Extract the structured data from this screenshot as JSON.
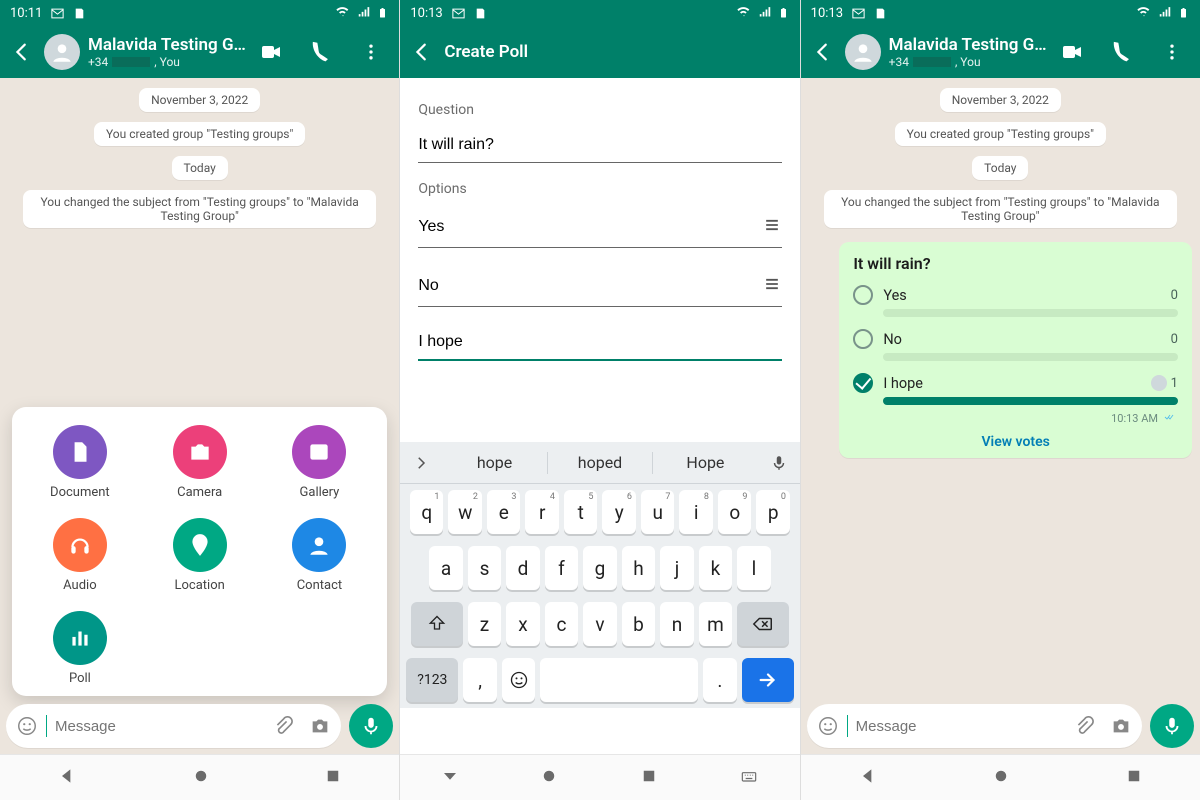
{
  "colors": {
    "teal": "#008069",
    "accent": "#00a884"
  },
  "shared": {
    "group_title": "Malavida Testing Group",
    "subtitle_prefix": "+34",
    "subtitle_suffix": ", You",
    "date_chip": "November 3, 2022",
    "created_chip": "You created group \"Testing groups\"",
    "today_chip": "Today",
    "subject_chip": "You changed the subject from \"Testing groups\" to \"Malavida Testing Group\"",
    "message_placeholder": "Message"
  },
  "screen1": {
    "status_time": "10:11",
    "attachments": [
      {
        "label": "Document",
        "icon": "doc",
        "color": "#7e57c2"
      },
      {
        "label": "Camera",
        "icon": "camera",
        "color": "#ec407a"
      },
      {
        "label": "Gallery",
        "icon": "gallery",
        "color": "#ab47bc"
      },
      {
        "label": "Audio",
        "icon": "audio",
        "color": "#ff7043"
      },
      {
        "label": "Location",
        "icon": "location",
        "color": "#00a884"
      },
      {
        "label": "Contact",
        "icon": "contact",
        "color": "#1e88e5"
      },
      {
        "label": "Poll",
        "icon": "poll",
        "color": "#009688"
      }
    ]
  },
  "screen2": {
    "status_time": "10:13",
    "title": "Create Poll",
    "question_label": "Question",
    "question_value": "It will rain?",
    "options_label": "Options",
    "options": [
      "Yes",
      "No",
      "I hope"
    ],
    "suggestions": [
      "hope",
      "hoped",
      "Hope"
    ],
    "keyboard": {
      "row1": [
        "q",
        "w",
        "e",
        "r",
        "t",
        "y",
        "u",
        "i",
        "o",
        "p"
      ],
      "row1_sup": [
        "1",
        "2",
        "3",
        "4",
        "5",
        "6",
        "7",
        "8",
        "9",
        "0"
      ],
      "row2": [
        "a",
        "s",
        "d",
        "f",
        "g",
        "h",
        "j",
        "k",
        "l"
      ],
      "row3": [
        "z",
        "x",
        "c",
        "v",
        "b",
        "n",
        "m"
      ],
      "sym": "?123",
      "comma": ",",
      "period": "."
    }
  },
  "screen3": {
    "status_time": "10:13",
    "poll": {
      "question": "It will rain?",
      "time": "10:13 AM",
      "view_votes": "View votes",
      "options": [
        {
          "text": "Yes",
          "votes": 0,
          "selected": false,
          "avatar": false
        },
        {
          "text": "No",
          "votes": 0,
          "selected": false,
          "avatar": false
        },
        {
          "text": "I hope",
          "votes": 1,
          "selected": true,
          "avatar": true
        }
      ]
    }
  }
}
